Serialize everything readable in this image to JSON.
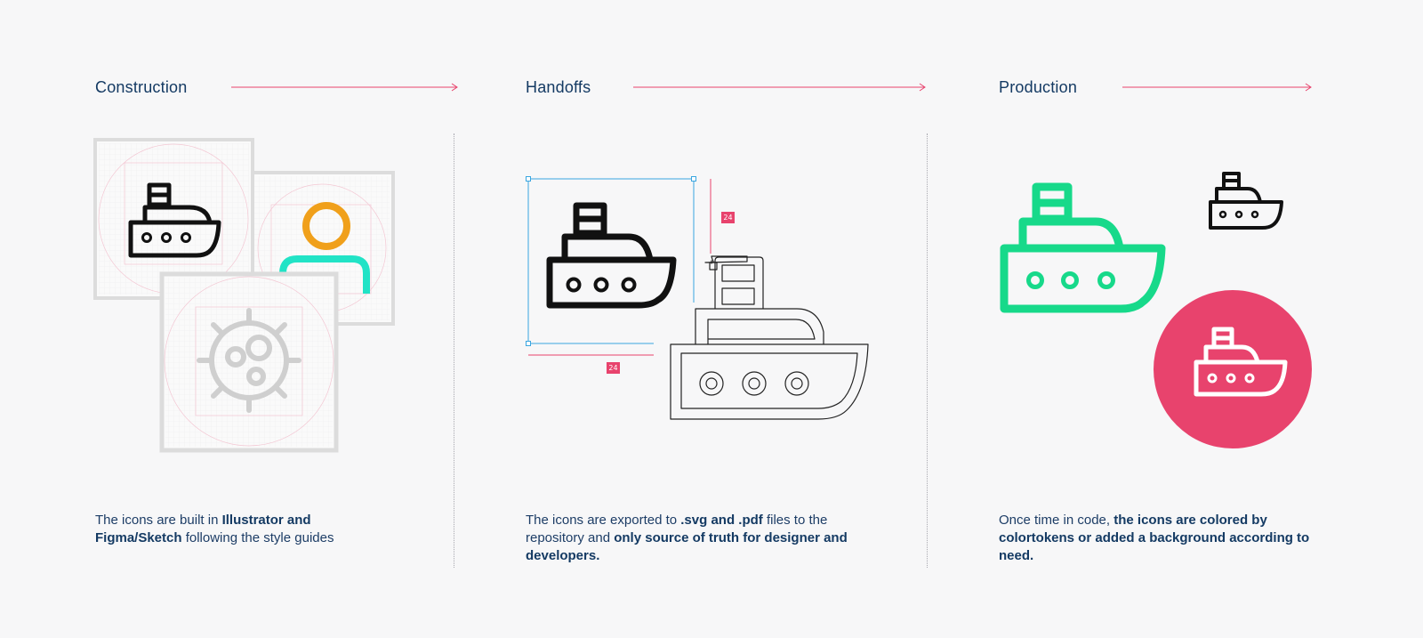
{
  "columns": [
    {
      "id": "construction",
      "heading": "Construction",
      "desc": [
        {
          "text": "The icons are built in ",
          "bold": false
        },
        {
          "text": "Illustrator and Figma/Sketch",
          "bold": true
        },
        {
          "text": " following the style guides",
          "bold": false
        }
      ]
    },
    {
      "id": "handoffs",
      "heading": "Handoffs",
      "desc": [
        {
          "text": "The icons are exported to ",
          "bold": false
        },
        {
          "text": ".svg and .pdf",
          "bold": true
        },
        {
          "text": " files to the repository and ",
          "bold": false
        },
        {
          "text": "only source of truth for designer and developers.",
          "bold": true
        }
      ]
    },
    {
      "id": "production",
      "heading": "Production",
      "desc": [
        {
          "text": "Once time in code, ",
          "bold": false
        },
        {
          "text": "the icons are colored by colortokens or added a background according to need.",
          "bold": true
        }
      ]
    }
  ],
  "dimension_labels": {
    "width": "24",
    "height": "24"
  },
  "colors": {
    "accent": "#e8436d",
    "heading": "#143a63",
    "green": "#17d98a",
    "orange": "#f0a01b",
    "teal": "#21e3c6",
    "selection": "#3aa6e0",
    "background": "#f7f7f8"
  },
  "icons": [
    "ship-icon",
    "person-icon",
    "virus-icon"
  ]
}
